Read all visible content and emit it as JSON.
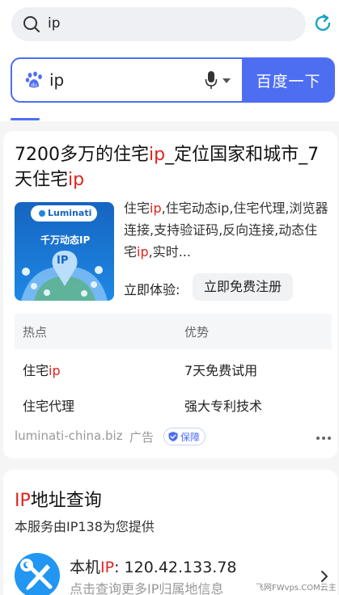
{
  "browser": {
    "url_text": "ip",
    "icons": {
      "search": "search-icon",
      "refresh": "refresh-icon"
    }
  },
  "search": {
    "query": "ip",
    "button_label": "百度一下",
    "icons": {
      "logo": "baidu-paw-icon",
      "mic": "microphone-icon",
      "dropdown": "chevron-down-icon"
    }
  },
  "ad_result": {
    "title_parts": [
      "7200多万的住宅",
      "ip",
      "_定位国家和城市_7天住宅",
      "ip"
    ],
    "thumbnail": {
      "brand": "Luminati",
      "caption": "千万动态IP",
      "badge": "IP"
    },
    "desc_parts": [
      "住宅",
      "ip",
      ",住宅动态ip,住宅代理,浏览器连接,支持验证码,反向连接,动态住宅",
      "ip",
      ",实时..."
    ],
    "try_label": "立即体验:",
    "register_label": "立即免费注册",
    "table": {
      "headers": [
        "热点",
        "优势"
      ],
      "rows": [
        {
          "hot_parts": [
            "住宅",
            "ip"
          ],
          "adv": "7天免费试用"
        },
        {
          "hot_parts": [
            "住宅代理",
            ""
          ],
          "adv": "强大专利技术"
        }
      ]
    },
    "source_url": "luminati-china.biz",
    "ad_label": "广告",
    "guarantee_label": "保障"
  },
  "ip_result": {
    "title_parts": [
      "IP",
      "地址查询"
    ],
    "subtitle": "本服务由IP138为您提供",
    "ip_label_parts": [
      "本机",
      "IP",
      ":  120.42.133.78"
    ],
    "hint": "点击查询更多IP归属地信息"
  },
  "watermark": "飞网FWvps.COM云主机",
  "colors": {
    "accent": "#4e6ef2",
    "highlight": "#e0241f",
    "tool_icon_bg": "#2196f3"
  }
}
